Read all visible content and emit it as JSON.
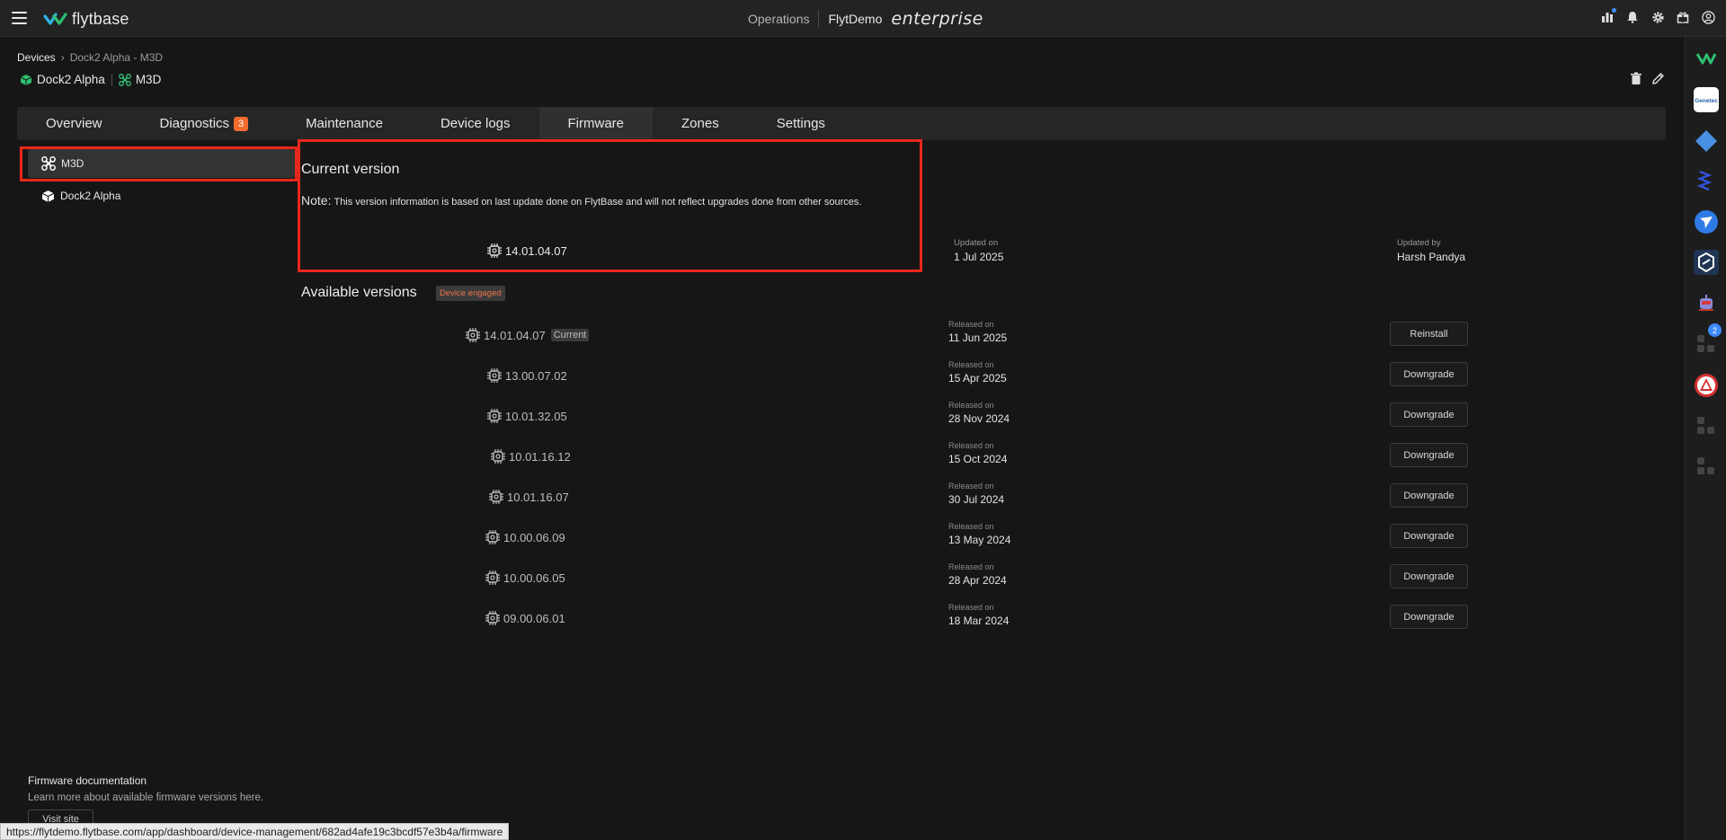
{
  "app": {
    "logo_text": "flytbase",
    "center_label": "Operations",
    "org": "FlytDemo",
    "edition": "enterprise"
  },
  "breadcrumb": {
    "root": "Devices",
    "sep": "›",
    "current": "Dock2 Alpha - M3D"
  },
  "device": {
    "dock": "Dock2 Alpha",
    "drone": "M3D"
  },
  "tabs": [
    {
      "label": "Overview"
    },
    {
      "label": "Diagnostics",
      "badge": "3"
    },
    {
      "label": "Maintenance"
    },
    {
      "label": "Device logs"
    },
    {
      "label": "Firmware",
      "active": true
    },
    {
      "label": "Zones"
    },
    {
      "label": "Settings"
    }
  ],
  "device_list": [
    {
      "label": "M3D",
      "icon": "drone-icon",
      "active": true
    },
    {
      "label": "Dock2 Alpha",
      "icon": "dock-icon"
    }
  ],
  "current": {
    "title": "Current version",
    "note_label": "Note:",
    "note_text": "This version information is based on last update done on FlytBase and will not reflect upgrades done from other sources.",
    "version": "14.01.04.07",
    "updated_label": "Updated on",
    "updated_value": "1 Jul 2025",
    "by_label": "Updated by",
    "by_value": "Harsh Pandya"
  },
  "available": {
    "title": "Available versions",
    "status_badge": "Device engaged",
    "released_label": "Released on",
    "current_tag": "Current",
    "versions": [
      {
        "version": "14.01.04.07",
        "released": "11 Jun 2025",
        "action": "Reinstall"
      },
      {
        "version": "13.00.07.02",
        "released": "15 Apr 2025",
        "action": "Downgrade"
      },
      {
        "version": "10.01.32.05",
        "released": "28 Nov 2024",
        "action": "Downgrade"
      },
      {
        "version": "10.01.16.12",
        "released": "15 Oct 2024",
        "action": "Downgrade"
      },
      {
        "version": "10.01.16.07",
        "released": "30 Jul 2024",
        "action": "Downgrade"
      },
      {
        "version": "10.00.06.09",
        "released": "13 May 2024",
        "action": "Downgrade"
      },
      {
        "version": "10.00.06.05",
        "released": "28 Apr 2024",
        "action": "Downgrade"
      },
      {
        "version": "09.00.06.01",
        "released": "18 Mar 2024",
        "action": "Downgrade"
      }
    ]
  },
  "footer": {
    "doc_title": "Firmware documentation",
    "doc_sub": "Learn more about available firmware versions here.",
    "visit_label": "Visit site",
    "status_url": "https://flytdemo.flytbase.com/app/dashboard/device-management/682ad4afe19c3bcdf57e3b4a/firmware"
  },
  "rail": {
    "notification_count": "2"
  },
  "colors": {
    "accent": "#f26b2d",
    "highlight": "#e8281c",
    "brand_green": "#2fbf71"
  }
}
